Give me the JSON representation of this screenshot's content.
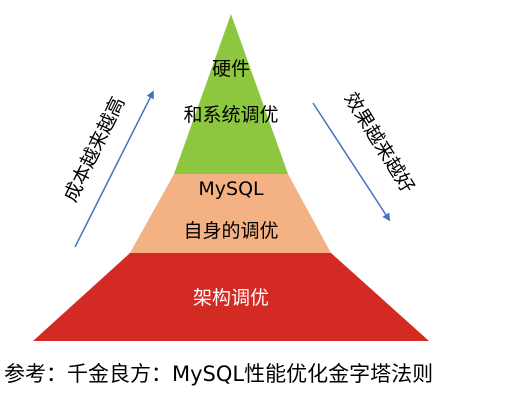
{
  "diagram": {
    "type": "pyramid",
    "tiers": [
      {
        "lines": [
          "硬件",
          "和系统调优"
        ],
        "color": "#8dc63f"
      },
      {
        "lines": [
          "MySQL",
          "自身的调优"
        ],
        "color": "#f4b183"
      },
      {
        "lines": [
          "架构调优"
        ],
        "color": "#d42a24"
      }
    ],
    "left_arrow_label": "成本越来越高",
    "right_arrow_label": "效果越来越好",
    "arrow_color": "#4472c4"
  },
  "caption": "参考：千金良方：MySQL性能优化金字塔法则"
}
